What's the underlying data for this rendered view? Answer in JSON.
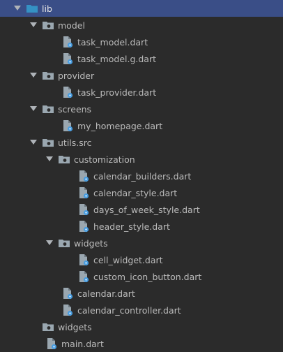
{
  "project_tree": {
    "nodes": [
      {
        "label": "lib",
        "icon": "folder-blue-icon",
        "expanded": true,
        "depth": 0
      },
      {
        "label": "model",
        "icon": "package-folder-icon",
        "expanded": true,
        "depth": 1
      },
      {
        "label": "task_model.dart",
        "icon": "dart-file-icon",
        "depth": 2
      },
      {
        "label": "task_model.g.dart",
        "icon": "dart-file-icon",
        "depth": 2
      },
      {
        "label": "provider",
        "icon": "package-folder-icon",
        "expanded": true,
        "depth": 1
      },
      {
        "label": "task_provider.dart",
        "icon": "dart-file-icon",
        "depth": 2
      },
      {
        "label": "screens",
        "icon": "package-folder-icon",
        "expanded": true,
        "depth": 1
      },
      {
        "label": "my_homepage.dart",
        "icon": "dart-file-icon",
        "depth": 2
      },
      {
        "label": "utils.src",
        "icon": "package-folder-icon",
        "expanded": true,
        "depth": 1
      },
      {
        "label": "customization",
        "icon": "package-folder-icon",
        "expanded": true,
        "depth": 2
      },
      {
        "label": "calendar_builders.dart",
        "icon": "dart-file-icon",
        "depth": 3
      },
      {
        "label": "calendar_style.dart",
        "icon": "dart-file-icon",
        "depth": 3
      },
      {
        "label": "days_of_week_style.dart",
        "icon": "dart-file-icon",
        "depth": 3
      },
      {
        "label": "header_style.dart",
        "icon": "dart-file-icon",
        "depth": 3
      },
      {
        "label": "widgets",
        "icon": "package-folder-icon",
        "expanded": true,
        "depth": 2
      },
      {
        "label": "cell_widget.dart",
        "icon": "dart-file-icon",
        "depth": 3
      },
      {
        "label": "custom_icon_button.dart",
        "icon": "dart-file-icon",
        "depth": 3
      },
      {
        "label": "calendar.dart",
        "icon": "dart-file-icon",
        "depth": 2
      },
      {
        "label": "calendar_controller.dart",
        "icon": "dart-file-icon",
        "depth": 2
      },
      {
        "label": "widgets",
        "icon": "package-folder-icon",
        "expanded": false,
        "depth": 1
      },
      {
        "label": "main.dart",
        "icon": "dart-file-icon",
        "depth": 1
      }
    ]
  },
  "colors": {
    "background": "#2b2b2b",
    "selection": "#3a4e87",
    "text": "#bbbbbb",
    "folder_blue": "#3592c4",
    "package_folder": "#9aa7b0",
    "dart_file": "#9aa7b0",
    "dart_badge": "#4a9ee0"
  }
}
